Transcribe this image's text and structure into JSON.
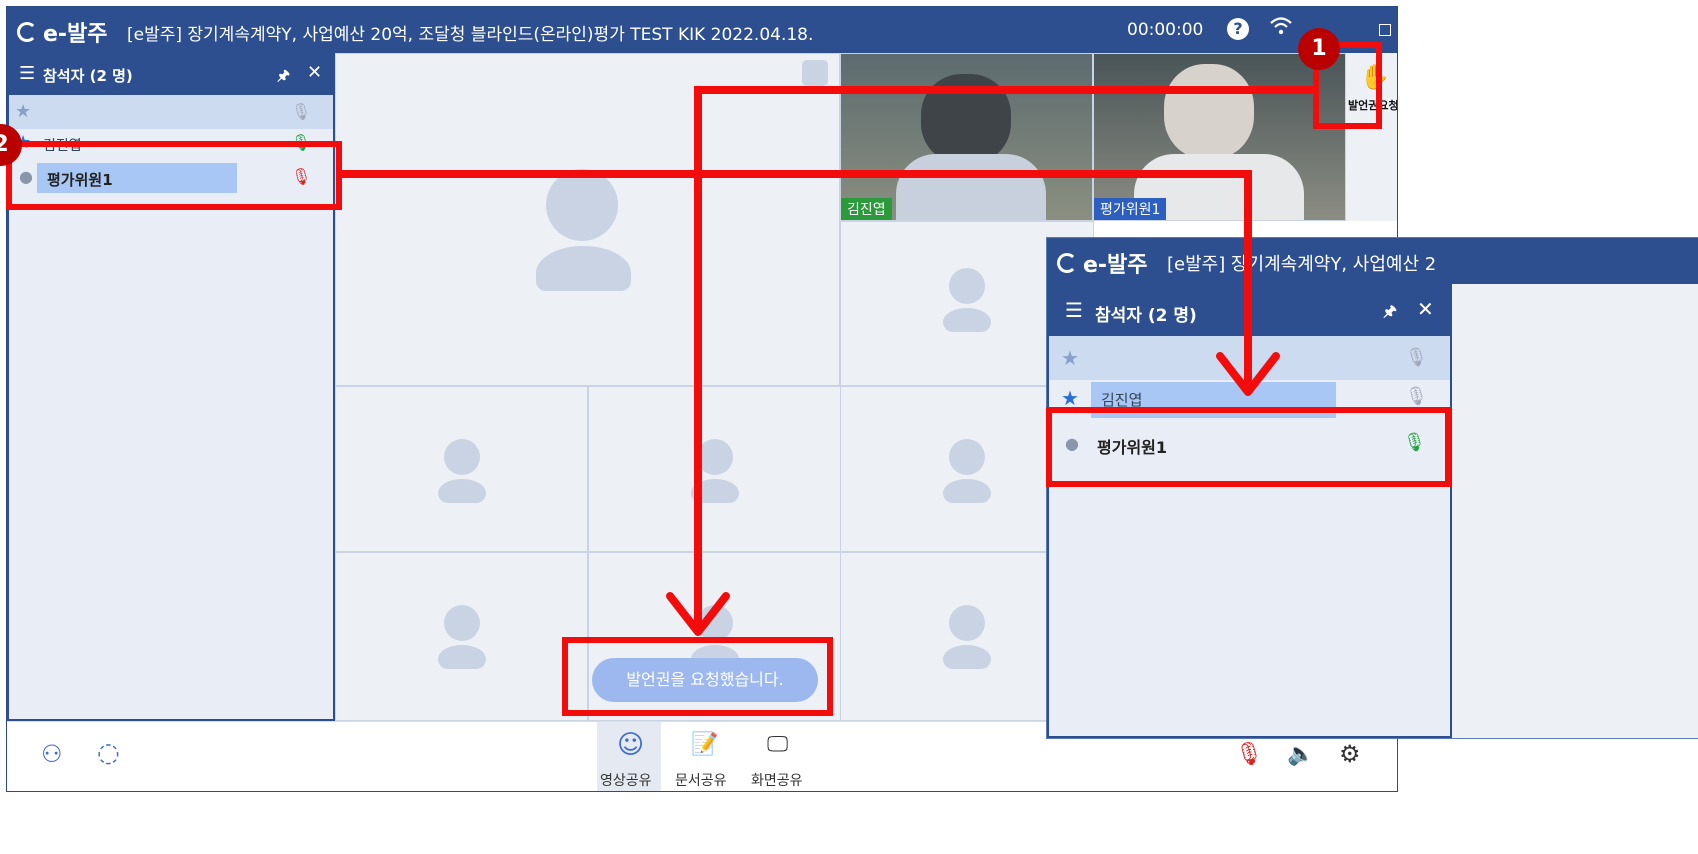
{
  "main_window": {
    "logo": "e-발주",
    "title": "[e발주] 장기계속계약Y, 사업예산 20억, 조달청 블라인드(온라인)평가 TEST KIK 2022.04.18.",
    "timer": "00:00:00",
    "help": "?",
    "participants_panel": {
      "header": "참석자 (2 명)",
      "participants": [
        {
          "name": "",
          "role": "host",
          "mic": "muted-gray"
        },
        {
          "name": "김진엽",
          "role": "host",
          "mic": "active"
        },
        {
          "name": "평가위원1",
          "role": "member",
          "mic": "muted-red"
        }
      ]
    },
    "video_tiles": [
      {
        "label": "김진엽"
      },
      {
        "label": "평가위원1"
      }
    ],
    "raise_hand_label": "발언권요청",
    "toast": "발언권을 요청했습니다.",
    "toolbar": {
      "video_share": "영상공유",
      "doc_share": "문서공유",
      "screen_share": "화면공유"
    }
  },
  "overlay_window": {
    "logo": "e-발주",
    "title": "[e발주] 장기계속계약Y, 사업예산 2",
    "participants_panel": {
      "header": "참석자 (2 명)",
      "participants": [
        {
          "name": "",
          "mic": "gray"
        },
        {
          "name": "김진엽",
          "mic": "gray"
        },
        {
          "name": "평가위원1",
          "mic": "active-green"
        }
      ]
    }
  },
  "annotations": {
    "badge_1": "1",
    "badge_2": "2"
  },
  "colors": {
    "titlebar": "#2d4f8f",
    "annotation_red": "#f20c0c",
    "toast_bg": "#9cb8ee",
    "selected_row": "#a9c7f5"
  }
}
